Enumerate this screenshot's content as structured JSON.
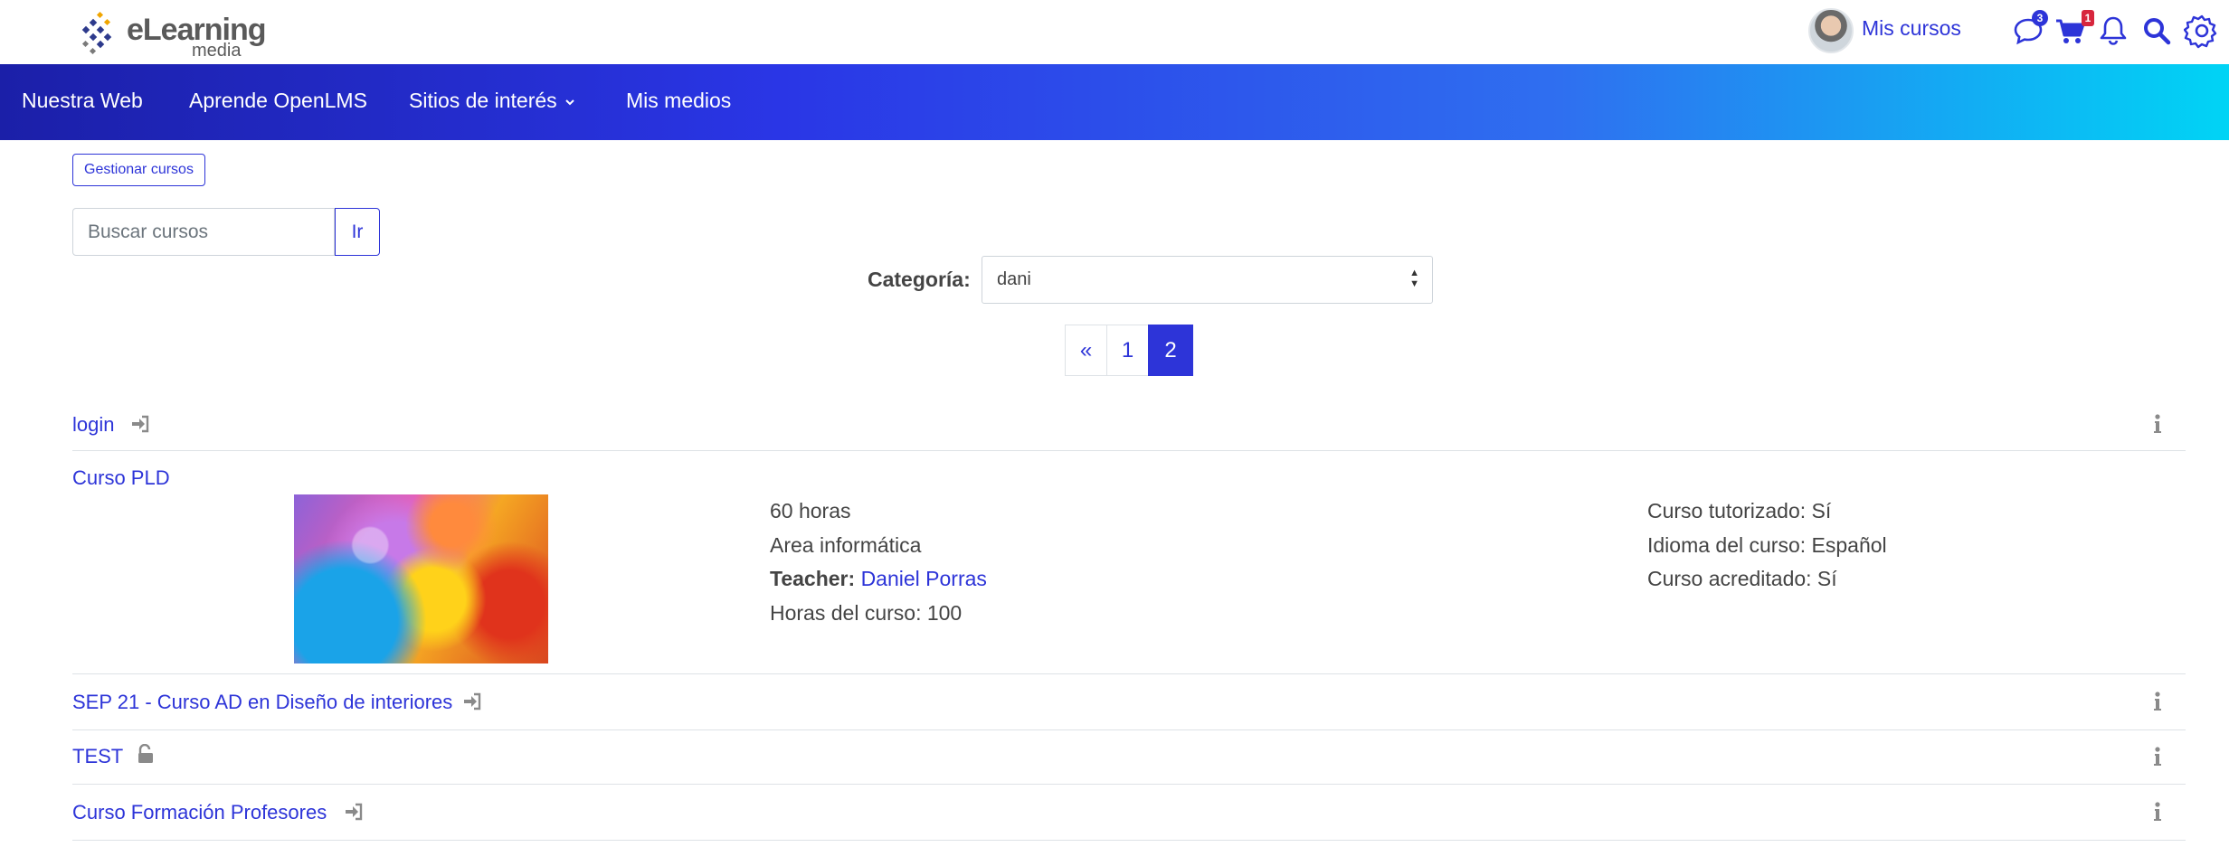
{
  "header": {
    "logo_text": "eLearning",
    "logo_sub": "media",
    "user_link": "Mis cursos",
    "messages_count": "3",
    "cart_count": "1"
  },
  "nav": {
    "items": [
      {
        "label": "Nuestra Web"
      },
      {
        "label": "Aprende OpenLMS"
      },
      {
        "label": "Sitios de interés"
      },
      {
        "label": "Mis medios"
      }
    ]
  },
  "toolbar": {
    "manage_label": "Gestionar cursos",
    "search_placeholder": "Buscar cursos",
    "search_value": "",
    "go_label": "Ir"
  },
  "category": {
    "label": "Categoría:",
    "selected": "dani"
  },
  "pagination": {
    "prev": "«",
    "pages": [
      "1",
      "2"
    ],
    "current": "2"
  },
  "courses": [
    {
      "name": "login",
      "access": "enrol-icon"
    },
    {
      "name": "Curso PLD",
      "details_left": [
        "60 horas",
        "Area informática"
      ],
      "teacher_label": "Teacher:",
      "teacher_name": "Daniel Porras",
      "hours": "Horas del curso: 100",
      "details_right": [
        "Curso tutorizado: Sí",
        "Idioma del curso: Español",
        "Curso acreditado: Sí"
      ]
    },
    {
      "name": "SEP 21 - Curso AD en Diseño de interiores",
      "access": "enrol-icon"
    },
    {
      "name": "TEST",
      "access": "unlock-icon"
    },
    {
      "name": "Curso Formación Profesores",
      "access": "enrol-icon"
    }
  ],
  "colors": {
    "accent": "#2d34d8",
    "nav_start": "#1b1fa8",
    "nav_end": "#00d4f5",
    "badge_red": "#d7263d"
  }
}
